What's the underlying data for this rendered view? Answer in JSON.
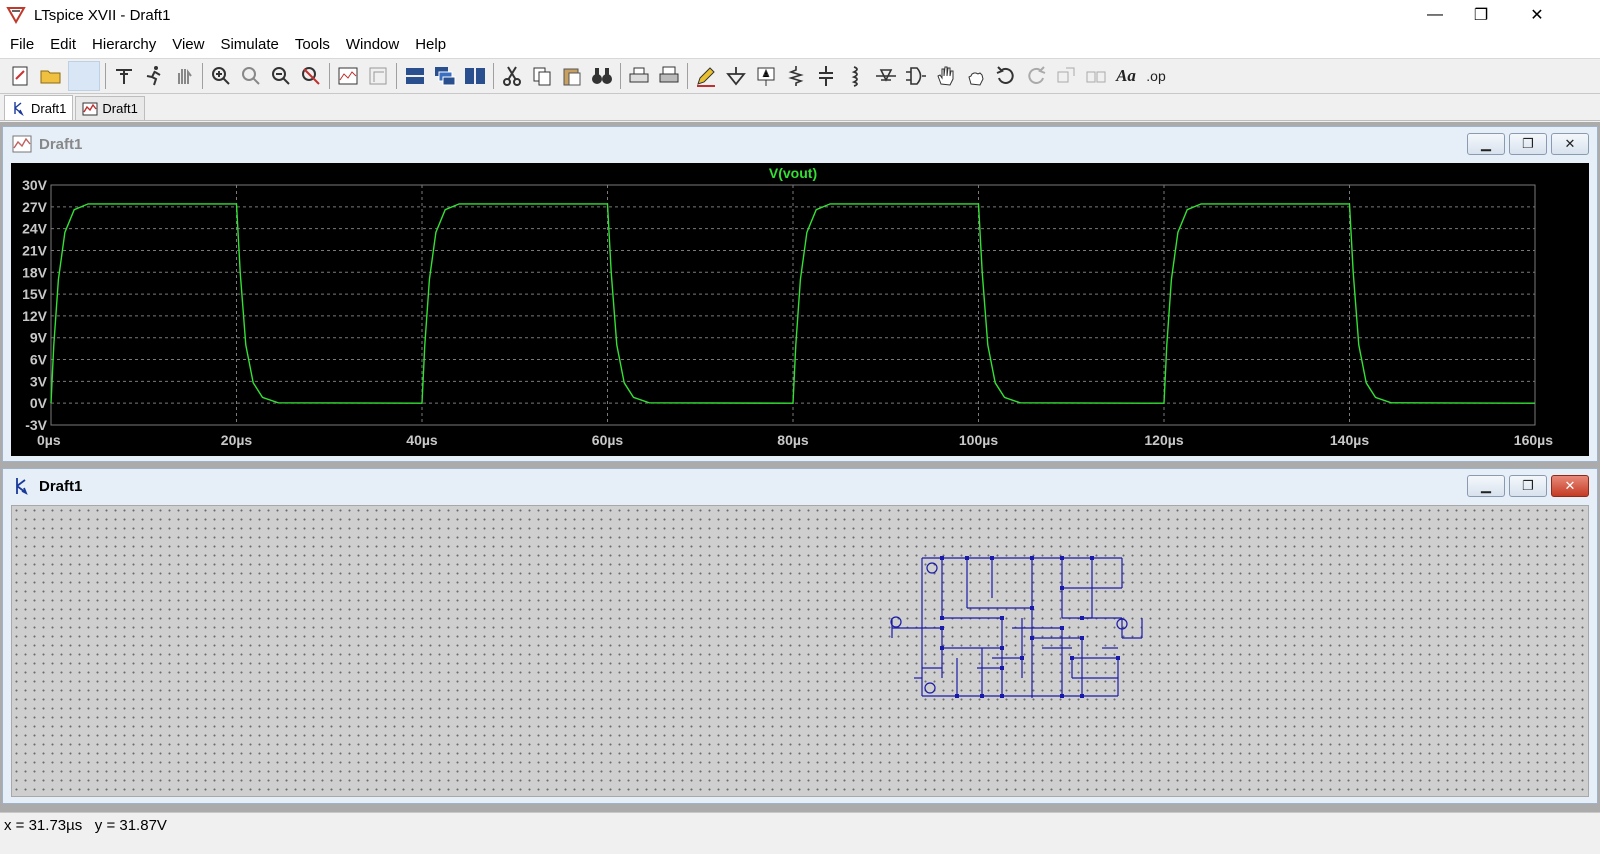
{
  "window": {
    "title": "LTspice XVII - Draft1",
    "controls": {
      "minimize": "—",
      "maximize": "❐",
      "close": "✕"
    }
  },
  "menu": [
    "File",
    "Edit",
    "Hierarchy",
    "View",
    "Simulate",
    "Tools",
    "Window",
    "Help"
  ],
  "toolbar": {
    "text_button_label": "Aa",
    "op_button_label": ".op"
  },
  "tabs": [
    {
      "label": "Draft1",
      "icon": "schematic-icon",
      "active": true
    },
    {
      "label": "Draft1",
      "icon": "waveform-icon",
      "active": false
    }
  ],
  "waveform_window": {
    "title": "Draft1",
    "icon": "waveform-icon"
  },
  "schematic_window": {
    "title": "Draft1",
    "icon": "schematic-icon"
  },
  "status": {
    "text": "x = 31.73µs   y = 31.87V"
  },
  "colors": {
    "trace": "#33e033",
    "plot_bg": "#000000",
    "grid": "#7a7a7a",
    "axis_text": "#c8c8c8",
    "schematic_wire": "#1a1aa8"
  },
  "chart_data": {
    "type": "line",
    "title": "V(vout)",
    "xlabel": "",
    "ylabel": "",
    "xlim": [
      0,
      160
    ],
    "ylim": [
      -3,
      30
    ],
    "x_unit": "µs",
    "y_unit": "V",
    "x_ticks": [
      "0µs",
      "20µs",
      "40µs",
      "60µs",
      "80µs",
      "100µs",
      "120µs",
      "140µs",
      "160µs"
    ],
    "y_ticks": [
      "30V",
      "27V",
      "24V",
      "21V",
      "18V",
      "15V",
      "12V",
      "9V",
      "6V",
      "3V",
      "0V",
      "-3V"
    ],
    "grid": true,
    "series": [
      {
        "name": "V(vout)",
        "x": [
          0,
          0.3,
          0.8,
          1.5,
          2.5,
          4,
          20,
          20.4,
          21,
          21.8,
          22.8,
          24.5,
          40,
          40.3,
          40.8,
          41.5,
          42.5,
          44,
          60,
          60.4,
          61,
          61.8,
          62.8,
          64.5,
          80,
          80.3,
          80.8,
          81.5,
          82.5,
          84,
          100,
          100.4,
          101,
          101.8,
          102.8,
          104.5,
          120,
          120.3,
          120.8,
          121.5,
          122.5,
          124,
          140,
          140.4,
          141,
          141.8,
          142.8,
          144.5,
          160
        ],
        "y": [
          0,
          8,
          17,
          23.5,
          26.6,
          27.4,
          27.4,
          18,
          8,
          2.8,
          0.8,
          0.05,
          0,
          8,
          17,
          23.5,
          26.6,
          27.4,
          27.4,
          18,
          8,
          2.8,
          0.8,
          0.05,
          0,
          8,
          17,
          23.5,
          26.6,
          27.4,
          27.4,
          18,
          8,
          2.8,
          0.8,
          0.05,
          0,
          8,
          17,
          23.5,
          26.6,
          27.4,
          27.4,
          18,
          8,
          2.8,
          0.8,
          0.05,
          0
        ]
      }
    ]
  }
}
